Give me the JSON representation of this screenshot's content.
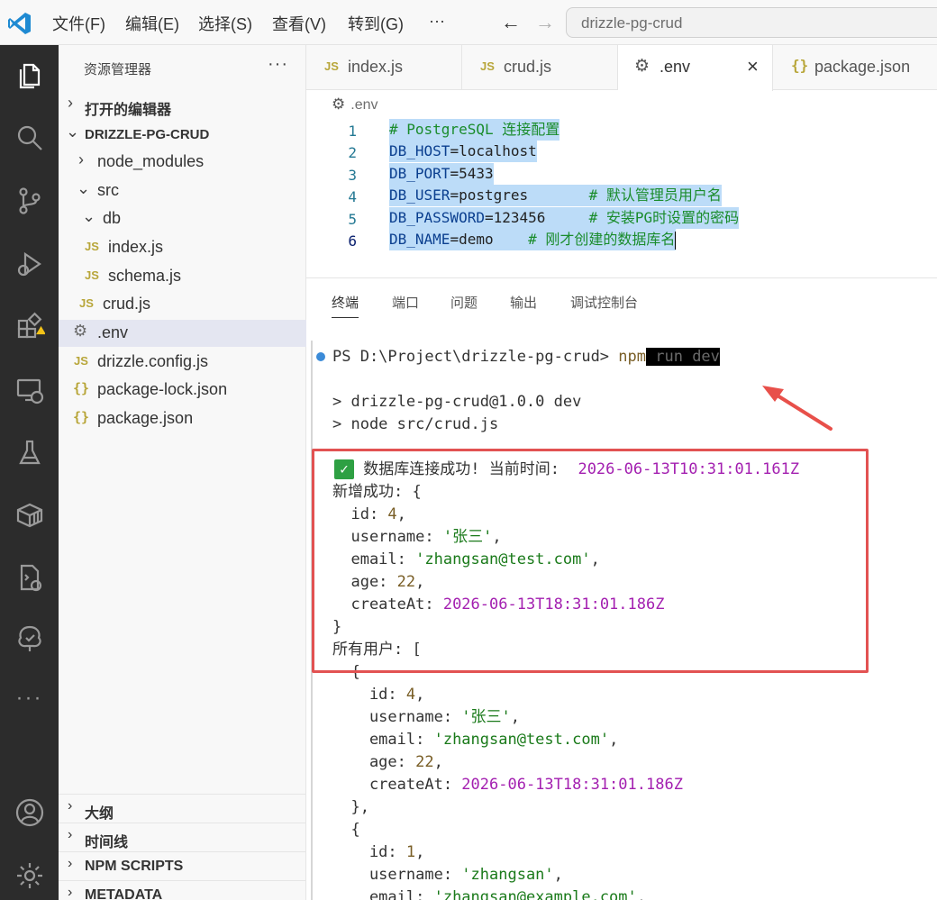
{
  "menubar": {
    "items": [
      "文件(F)",
      "编辑(E)",
      "选择(S)",
      "查看(V)",
      "转到(G)",
      "···"
    ],
    "search_value": "drizzle-pg-crud"
  },
  "sidebar": {
    "title": "资源管理器",
    "more": "···",
    "open_editors": "打开的编辑器",
    "project": "DRIZZLE-PG-CRUD",
    "tree": [
      {
        "label": "node_modules",
        "kind": "folder-closed"
      },
      {
        "label": "src",
        "kind": "folder-open"
      },
      {
        "label": "db",
        "kind": "folder-open"
      },
      {
        "label": "index.js",
        "kind": "js"
      },
      {
        "label": "schema.js",
        "kind": "js"
      },
      {
        "label": "crud.js",
        "kind": "js"
      },
      {
        "label": ".env",
        "kind": "env",
        "active": true
      },
      {
        "label": "drizzle.config.js",
        "kind": "js"
      },
      {
        "label": "package-lock.json",
        "kind": "json"
      },
      {
        "label": "package.json",
        "kind": "json"
      }
    ],
    "sections": [
      "大纲",
      "时间线",
      "NPM SCRIPTS",
      "METADATA"
    ],
    "js_badge": "JS",
    "json_badge": "{}"
  },
  "tabs": [
    {
      "label": "index.js",
      "icon": "js"
    },
    {
      "label": "crud.js",
      "icon": "js"
    },
    {
      "label": ".env",
      "icon": "gear",
      "active": true
    },
    {
      "label": "package.json",
      "icon": "json"
    }
  ],
  "breadcrumb": ".env",
  "editor": {
    "lines": [
      {
        "n": "1",
        "text": "# PostgreSQL 连接配置"
      },
      {
        "n": "2",
        "key": "DB_HOST",
        "val": "localhost"
      },
      {
        "n": "3",
        "key": "DB_PORT",
        "val": "5433"
      },
      {
        "n": "4",
        "key": "DB_USER",
        "val": "postgres",
        "pad": "       ",
        "comment": "# 默认管理员用户名"
      },
      {
        "n": "5",
        "key": "DB_PASSWORD",
        "val": "123456",
        "pad": "     ",
        "comment": "# 安装PG时设置的密码"
      },
      {
        "n": "6",
        "key": "DB_NAME",
        "val": "demo",
        "pad": "    ",
        "comment": "# 刚才创建的数据库名"
      }
    ]
  },
  "panel": {
    "tabs": [
      "终端",
      "端口",
      "问题",
      "输出",
      "调试控制台"
    ],
    "prompt": "PS D:\\Project\\drizzle-pg-crud>",
    "cmd_npm": "npm",
    "cmd_rest": " run dev",
    "out1": "> drizzle-pg-crud@1.0.0 dev",
    "out2": "> node src/crud.js",
    "check": "✓",
    "connect_msg": "数据库连接成功! 当前时间:",
    "connect_time": "2026-06-13T10:31:01.161Z",
    "added": "新增成功: {",
    "u1": {
      "id": "4",
      "username": "'张三'",
      "email": "'zhangsan@test.com'",
      "age": "22",
      "createAt": "2026-06-13T18:31:01.186Z"
    },
    "all_users": "所有用户: [",
    "u2": {
      "id": "1",
      "username": "'zhangsan'",
      "email": "'zhangsan@example.com'"
    }
  }
}
